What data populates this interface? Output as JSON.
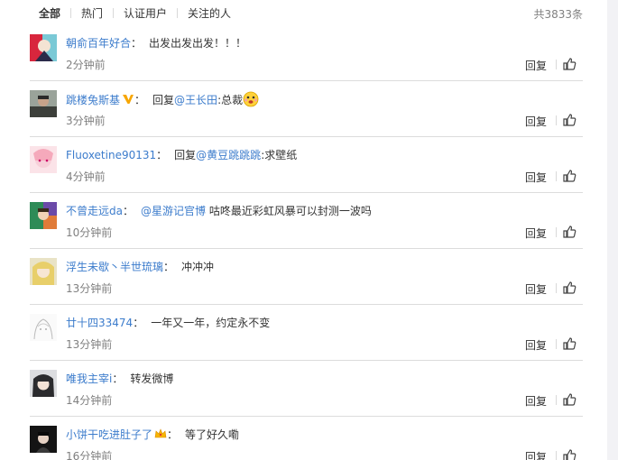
{
  "tabs": [
    {
      "label": "全部",
      "active": true
    },
    {
      "label": "热门",
      "active": false
    },
    {
      "label": "认证用户",
      "active": false
    },
    {
      "label": "关注的人",
      "active": false
    }
  ],
  "total": "共3833条",
  "reply_label": "回复",
  "comments": [
    {
      "user": "朝俞百年好合",
      "text": "出发出发出发！！！",
      "time": "2分钟前"
    },
    {
      "user": "跳楼兔斯基",
      "reply_prefix": "回复",
      "mention": "@王长田",
      "text": ":总裁",
      "time": "3分钟前",
      "badge": "vip-v-icon",
      "emoji": "smiley-emoji-icon"
    },
    {
      "user": "Fluoxetine90131",
      "reply_prefix": "回复",
      "mention": "@黄豆跳跳跳",
      "text": ":求壁纸",
      "time": "4分钟前"
    },
    {
      "user": "不曾走远da",
      "mention": "@星游记官博",
      "text": " 咕咚最近彩虹风暴可以封测一波吗",
      "time": "10分钟前"
    },
    {
      "user": "浮生未歇丶半世琉璃",
      "text": "冲冲冲",
      "time": "13分钟前"
    },
    {
      "user": "廿十四33474",
      "text": "一年又一年，约定永不变",
      "time": "13分钟前"
    },
    {
      "user": "唯我主宰i",
      "text": "转发微博",
      "time": "14分钟前"
    },
    {
      "user": "小饼干吃进肚子了",
      "text": "等了好久嘞",
      "time": "16分钟前",
      "badge": "crown-icon"
    }
  ],
  "colors": {
    "link": "#3c7ccc",
    "muted": "#808080",
    "divider": "#dcdcdc"
  }
}
